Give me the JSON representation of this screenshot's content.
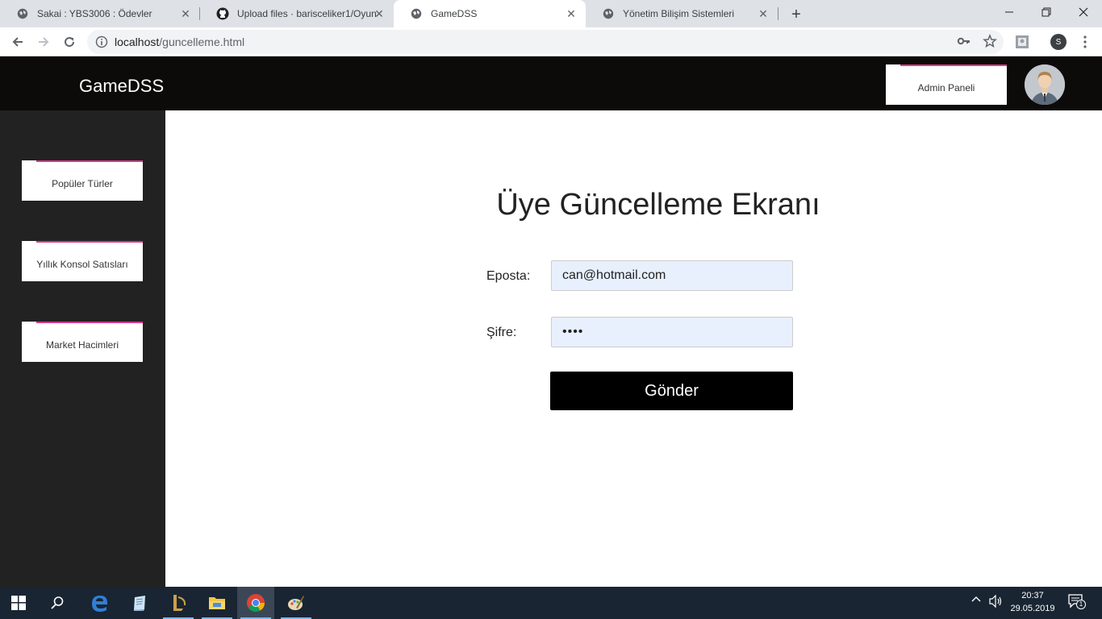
{
  "browser": {
    "tabs": [
      {
        "title": "Sakai : YBS3006 : Ödevler",
        "icon": "globe-icon",
        "active": false
      },
      {
        "title": "Upload files · barisceliker1/Oyun-",
        "icon": "github-icon",
        "active": false
      },
      {
        "title": "GameDSS",
        "icon": "globe-icon",
        "active": true
      },
      {
        "title": "Yönetim Bilişim Sistemleri",
        "icon": "globe-icon",
        "active": false
      }
    ],
    "url_host": "localhost",
    "url_path": "/guncelleme.html",
    "profile_initial": "S"
  },
  "header": {
    "brand": "GameDSS",
    "admin_button": "Admin Paneli"
  },
  "sidebar": {
    "items": [
      {
        "label": "Popüler Türler"
      },
      {
        "label": "Yıllık Konsol Satısları"
      },
      {
        "label": "Market Hacimleri"
      }
    ]
  },
  "form": {
    "title": "Üye Güncelleme Ekranı",
    "email_label": "Eposta:",
    "email_value": "can@hotmail.com",
    "password_label": "Şifre:",
    "password_value": "••••",
    "submit_label": "Gönder"
  },
  "taskbar": {
    "time": "20:37",
    "date": "29.05.2019",
    "notifications": "1"
  },
  "colors": {
    "header_bg": "#0d0a0a",
    "sidebar_bg": "#222222",
    "accent_pink": "#d63a8c",
    "input_bg": "#e8f0fe",
    "button_bg": "#000000"
  }
}
